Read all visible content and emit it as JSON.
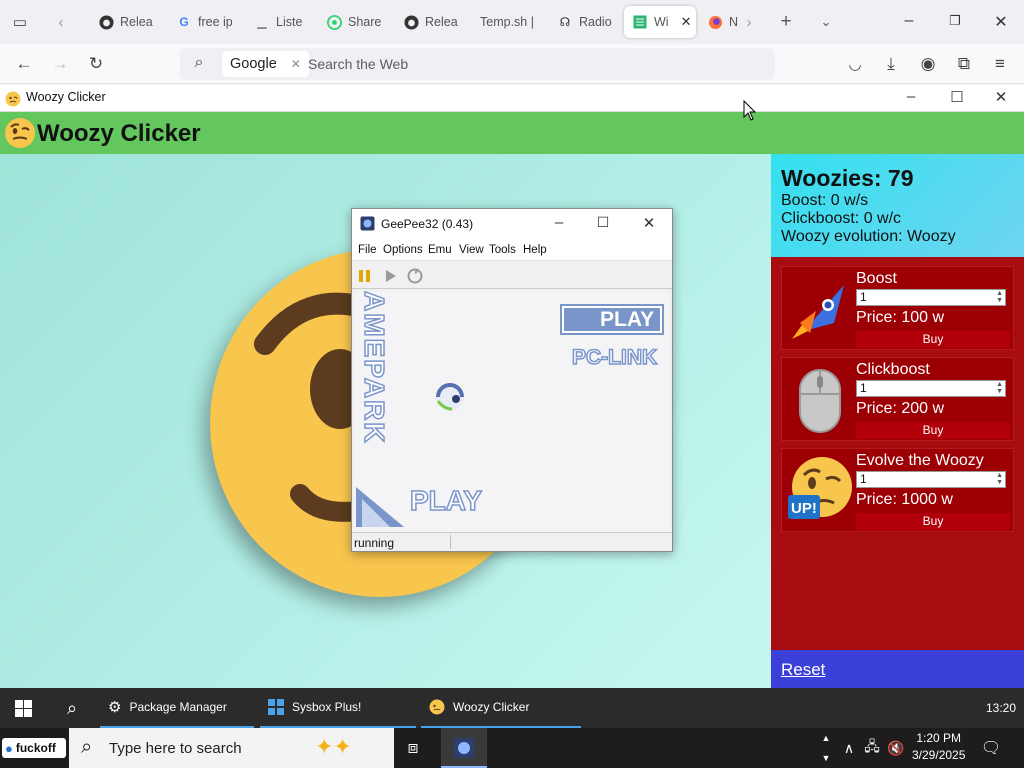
{
  "browser": {
    "tabs": [
      {
        "label": "Relea",
        "icon": "github-icon"
      },
      {
        "label": "free ip",
        "icon": "google-icon"
      },
      {
        "label": "Liste",
        "icon": "page-icon"
      },
      {
        "label": "Share",
        "icon": "whatsapp-icon"
      },
      {
        "label": "Relea",
        "icon": "github-icon"
      },
      {
        "label": "Temp.sh |",
        "icon": "none"
      },
      {
        "label": "Radio",
        "icon": "radio-icon"
      },
      {
        "label": "Wi",
        "icon": "window-icon"
      },
      {
        "label": "N",
        "icon": "firefox-icon"
      }
    ],
    "search_engine": "Google",
    "url_placeholder": "Search the Web"
  },
  "app": {
    "window_title": "Woozy Clicker",
    "header_title": "Woozy Clicker",
    "stats": {
      "woozies": "Woozies: 79",
      "boost": "Boost: 0 w/s",
      "clickboost": "Clickboost: 0 w/c",
      "evolution": "Woozy evolution: Woozy"
    },
    "shop": [
      {
        "name": "Boost",
        "qty": "1",
        "price": "Price: 100 w",
        "buy": "Buy",
        "icon": "rocket-icon"
      },
      {
        "name": "Clickboost",
        "qty": "1",
        "price": "Price: 200 w",
        "buy": "Buy",
        "icon": "mouse-icon"
      },
      {
        "name": "Evolve the Woozy",
        "qty": "1",
        "price": "Price: 1000 w",
        "buy": "Buy",
        "icon": "woozy-up-icon"
      }
    ],
    "reset": "Reset",
    "colors": {
      "header": "#63c75e",
      "panel": "#a70d10",
      "reset": "#3b40d8"
    }
  },
  "emulator": {
    "title": "GeePee32 (0.43)",
    "menu": [
      "File",
      "Options",
      "Emu",
      "View",
      "Tools",
      "Help"
    ],
    "screen_text": {
      "play_top": "PLAY",
      "pclink": "PC-LINK",
      "play_bottom": "PLAY",
      "side": "AMEPARK G"
    },
    "status": "running"
  },
  "dock": {
    "tasks": [
      "Package Manager",
      "Sysbox Plus!",
      "Woozy Clicker"
    ],
    "time": "13:20"
  },
  "taskbar": {
    "start_label": "fuckoff",
    "search_placeholder": "Type here to search",
    "time": "1:20 PM",
    "date": "3/29/2025"
  }
}
